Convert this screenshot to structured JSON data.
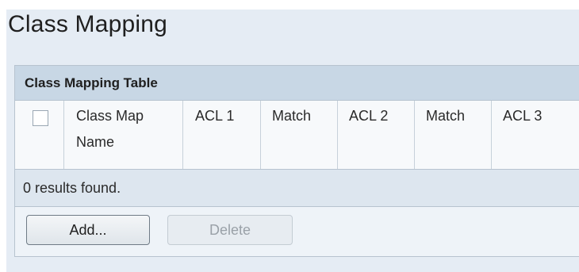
{
  "page": {
    "title": "Class Mapping"
  },
  "table": {
    "title": "Class Mapping Table",
    "columns": [
      {
        "line1": "Class Map",
        "line2": "Name"
      },
      {
        "line1": "ACL 1",
        "line2": ""
      },
      {
        "line1": "Match",
        "line2": ""
      },
      {
        "line1": "ACL 2",
        "line2": ""
      },
      {
        "line1": "Match",
        "line2": ""
      },
      {
        "line1": "ACL 3",
        "line2": ""
      }
    ],
    "results_text": "0 results found."
  },
  "buttons": {
    "add_label": "Add...",
    "delete_label": "Delete"
  }
}
